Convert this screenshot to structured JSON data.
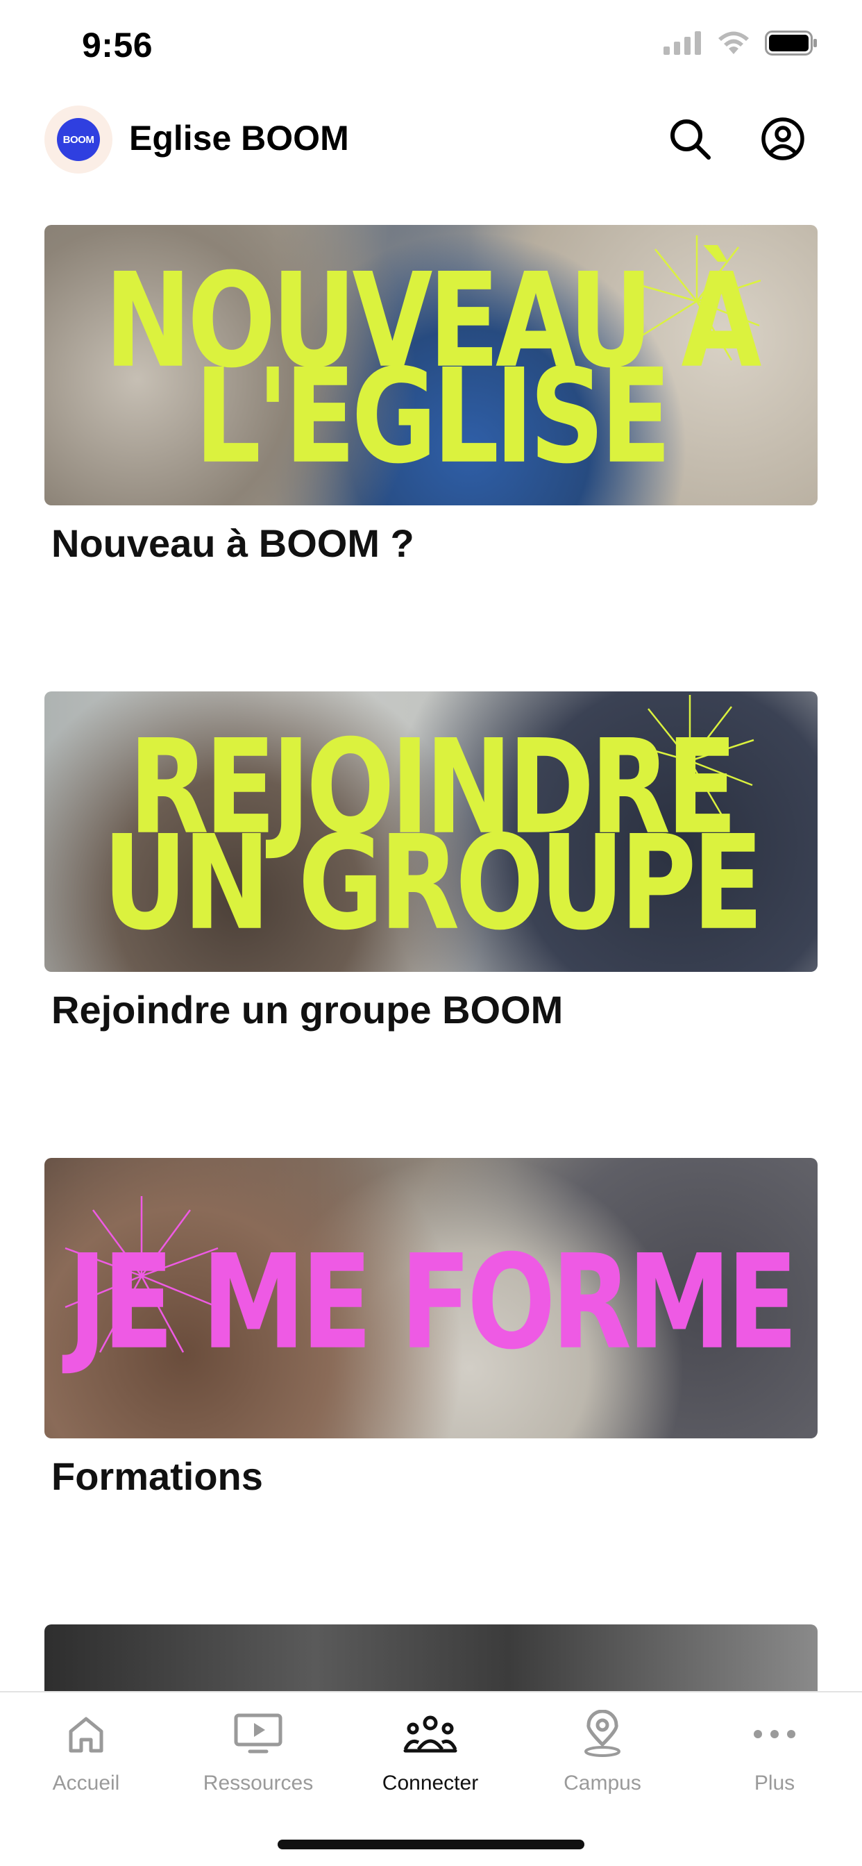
{
  "status_bar": {
    "time": "9:56"
  },
  "header": {
    "logo_text": "BOOM",
    "title": "Eglise BOOM"
  },
  "cards": [
    {
      "banner_lines": [
        "NOUVEAU À",
        "L'EGLISE"
      ],
      "banner_color": "#dbf23e",
      "title": "Nouveau à BOOM ?"
    },
    {
      "banner_lines": [
        "REJOINDRE",
        "UN GROUPE"
      ],
      "banner_color": "#dbf23e",
      "title": "Rejoindre un groupe BOOM"
    },
    {
      "banner_lines": [
        "JE ME FORME"
      ],
      "banner_color": "#ee5ae4",
      "title": "Formations"
    }
  ],
  "tabs": [
    {
      "label": "Accueil",
      "icon": "home-icon",
      "active": false
    },
    {
      "label": "Ressources",
      "icon": "tv-play-icon",
      "active": false
    },
    {
      "label": "Connecter",
      "icon": "people-icon",
      "active": true
    },
    {
      "label": "Campus",
      "icon": "map-pin-icon",
      "active": false
    },
    {
      "label": "Plus",
      "icon": "more-dots-icon",
      "active": false
    }
  ],
  "colors": {
    "inactive_tab": "#9a9a9a",
    "active_tab": "#111111",
    "logo_blue": "#2f3fe0"
  }
}
